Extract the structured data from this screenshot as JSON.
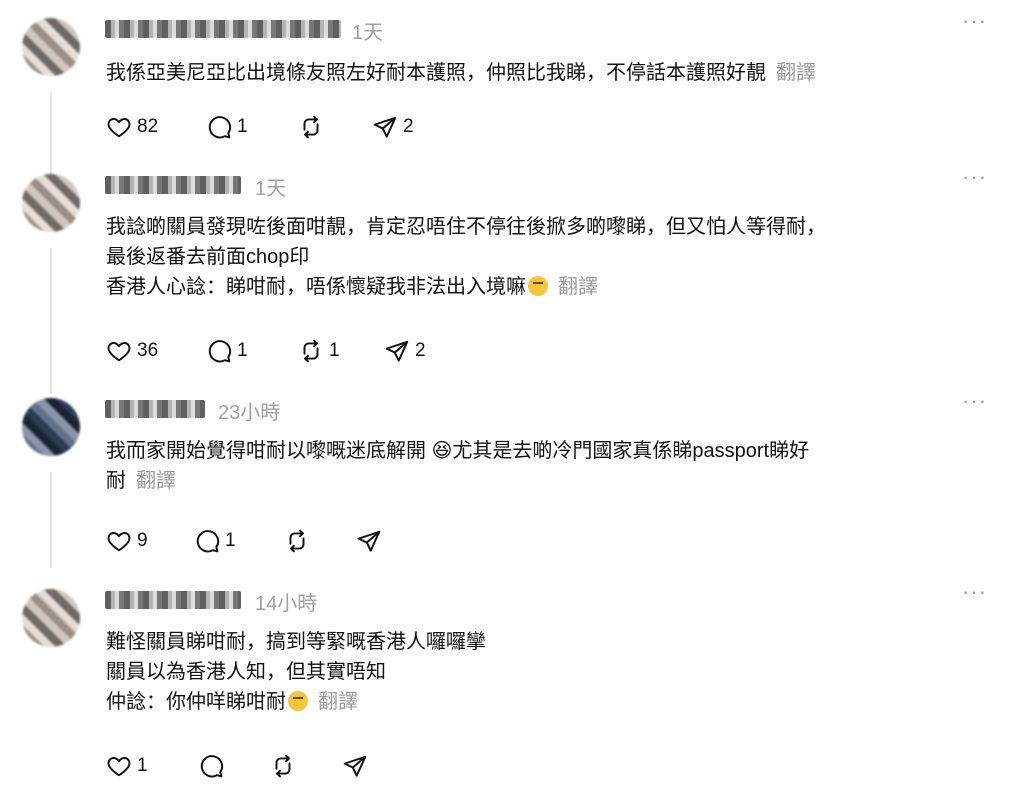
{
  "ui": {
    "more_glyph": "···",
    "translate_label": "翻譯",
    "icons": [
      "heart-icon",
      "comment-icon",
      "repost-icon",
      "share-icon",
      "more-icon"
    ]
  },
  "posts": [
    {
      "time": "1天",
      "lines": [
        "我係亞美尼亞比出境條友照左好耐本護照，仲照比我睇，不停話本護照好靚"
      ],
      "likes": "82",
      "comments": "1",
      "reposts": "",
      "shares": "2"
    },
    {
      "time": "1天",
      "lines": [
        "我諗啲關員發現咗後面咁靚，肯定忍唔住不停往後掀多啲嚟睇，但又怕人等得耐，",
        "最後返番去前面chop印",
        "香港人心諗：睇咁耐，唔係懷疑我非法出入境嘛"
      ],
      "emoji_name": "face-with-raised-eyebrow-emoji",
      "likes": "36",
      "comments": "1",
      "reposts": "1",
      "shares": "2"
    },
    {
      "time": "23小時",
      "lines": [
        "我而家開始覺得咁耐以嚟嘅迷底解開 😆尤其是去啲冷門國家真係睇passport睇好",
        "耐"
      ],
      "likes": "9",
      "comments": "1",
      "reposts": "",
      "shares": ""
    },
    {
      "time": "14小時",
      "lines": [
        "難怪關員睇咁耐，搞到等緊嘅香港人囉囉攣",
        "關員以為香港人知，但其實唔知",
        "仲諗：你仲咩睇咁耐"
      ],
      "emoji_name": "face-with-raised-eyebrow-emoji",
      "likes": "1",
      "comments": "",
      "reposts": "",
      "shares": ""
    }
  ]
}
